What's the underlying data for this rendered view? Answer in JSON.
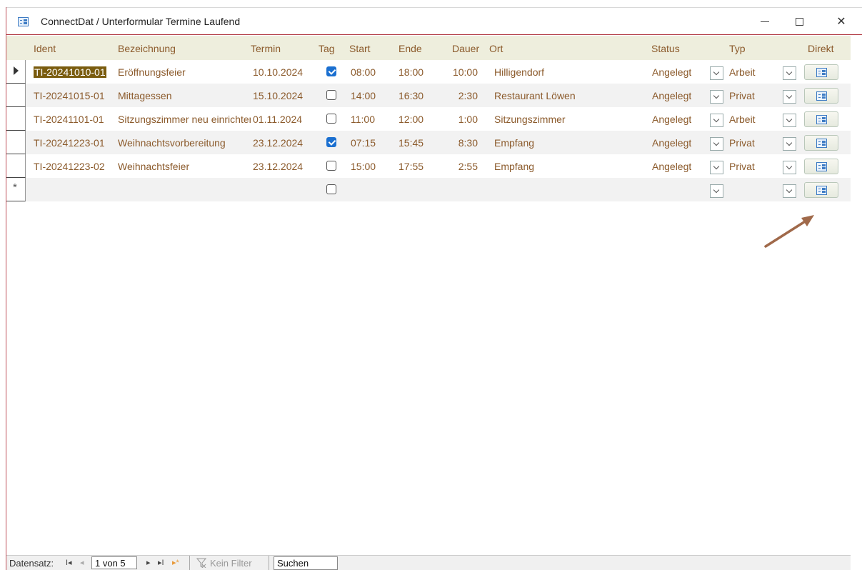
{
  "window": {
    "title": "ConnectDat / Unterformular Termine Laufend",
    "min_glyph": "—",
    "close_glyph": "✕"
  },
  "columns": {
    "ident": "Ident",
    "bezeichnung": "Bezeichnung",
    "termin": "Termin",
    "tag": "Tag",
    "start": "Start",
    "ende": "Ende",
    "dauer": "Dauer",
    "ort": "Ort",
    "status": "Status",
    "typ": "Typ",
    "direkt": "Direkt"
  },
  "rows": [
    {
      "ident": "TI-20241010-01",
      "bezeichnung": "Eröffnungsfeier",
      "termin": "10.10.2024",
      "tag": true,
      "start": "08:00",
      "ende": "18:00",
      "dauer": "10:00",
      "ort": "Hilligendorf",
      "status": "Angelegt",
      "typ": "Arbeit"
    },
    {
      "ident": "TI-20241015-01",
      "bezeichnung": "Mittagessen",
      "termin": "15.10.2024",
      "tag": false,
      "start": "14:00",
      "ende": "16:30",
      "dauer": "2:30",
      "ort": "Restaurant Löwen",
      "status": "Angelegt",
      "typ": "Privat"
    },
    {
      "ident": "TI-20241101-01",
      "bezeichnung": "Sitzungszimmer neu einrichten",
      "termin": "01.11.2024",
      "tag": false,
      "start": "11:00",
      "ende": "12:00",
      "dauer": "1:00",
      "ort": "Sitzungszimmer",
      "status": "Angelegt",
      "typ": "Arbeit"
    },
    {
      "ident": "TI-20241223-01",
      "bezeichnung": "Weihnachtsvorbereitung",
      "termin": "23.12.2024",
      "tag": true,
      "start": "07:15",
      "ende": "15:45",
      "dauer": "8:30",
      "ort": "Empfang",
      "status": "Angelegt",
      "typ": "Privat"
    },
    {
      "ident": "TI-20241223-02",
      "bezeichnung": "Weihnachtsfeier",
      "termin": "23.12.2024",
      "tag": false,
      "start": "15:00",
      "ende": "17:55",
      "dauer": "2:55",
      "ort": "Empfang",
      "status": "Angelegt",
      "typ": "Privat"
    }
  ],
  "new_row_marker": "*",
  "navbar": {
    "label": "Datensatz:",
    "first": "I◂",
    "prev": "◂",
    "record_position": "1 von 5",
    "next": "▸",
    "last": "▸I",
    "new": "▸*",
    "filter_label": "Kein Filter",
    "search_value": "Suchen"
  },
  "colors": {
    "accent_border": "#b0363f",
    "text_brown": "#8b5a2b",
    "header_bg": "#eeeedd",
    "selection_bg": "#7a5c0f",
    "checkbox_on": "#1a6fd0",
    "arrow": "#a0694a"
  }
}
